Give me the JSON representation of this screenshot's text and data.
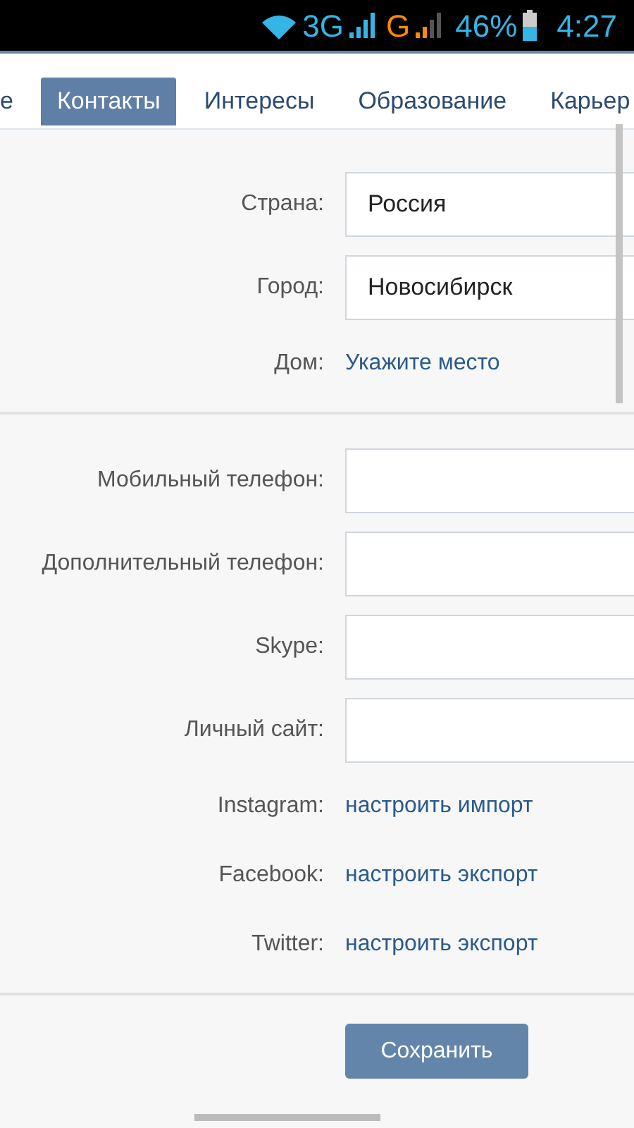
{
  "status_bar": {
    "network_1": "3G",
    "network_2": "G",
    "battery": "46%",
    "time": "4:27"
  },
  "tabs": [
    {
      "label": "е",
      "selected": false
    },
    {
      "label": "Контакты",
      "selected": true
    },
    {
      "label": "Интересы",
      "selected": false
    },
    {
      "label": "Образование",
      "selected": false
    },
    {
      "label": "Карьер",
      "selected": false
    }
  ],
  "sections": [
    {
      "rows": [
        {
          "kind": "field",
          "label": "Страна:",
          "value": "Россия"
        },
        {
          "kind": "field",
          "label": "Город:",
          "value": "Новосибирск"
        },
        {
          "kind": "link",
          "label": "Дом:",
          "link": "Укажите место"
        }
      ]
    },
    {
      "rows": [
        {
          "kind": "field",
          "label": "Мобильный телефон:"
        },
        {
          "kind": "field",
          "label": "Дополнительный телефон:"
        },
        {
          "kind": "field",
          "label": "Skype:"
        },
        {
          "kind": "field",
          "label": "Личный сайт:"
        },
        {
          "kind": "link",
          "label": "Instagram:",
          "link": "настроить импорт"
        },
        {
          "kind": "link",
          "label": "Facebook:",
          "link": "настроить экспорт"
        },
        {
          "kind": "link",
          "label": "Twitter:",
          "link": "настроить экспорт"
        }
      ]
    }
  ],
  "save_button": "Сохранить"
}
